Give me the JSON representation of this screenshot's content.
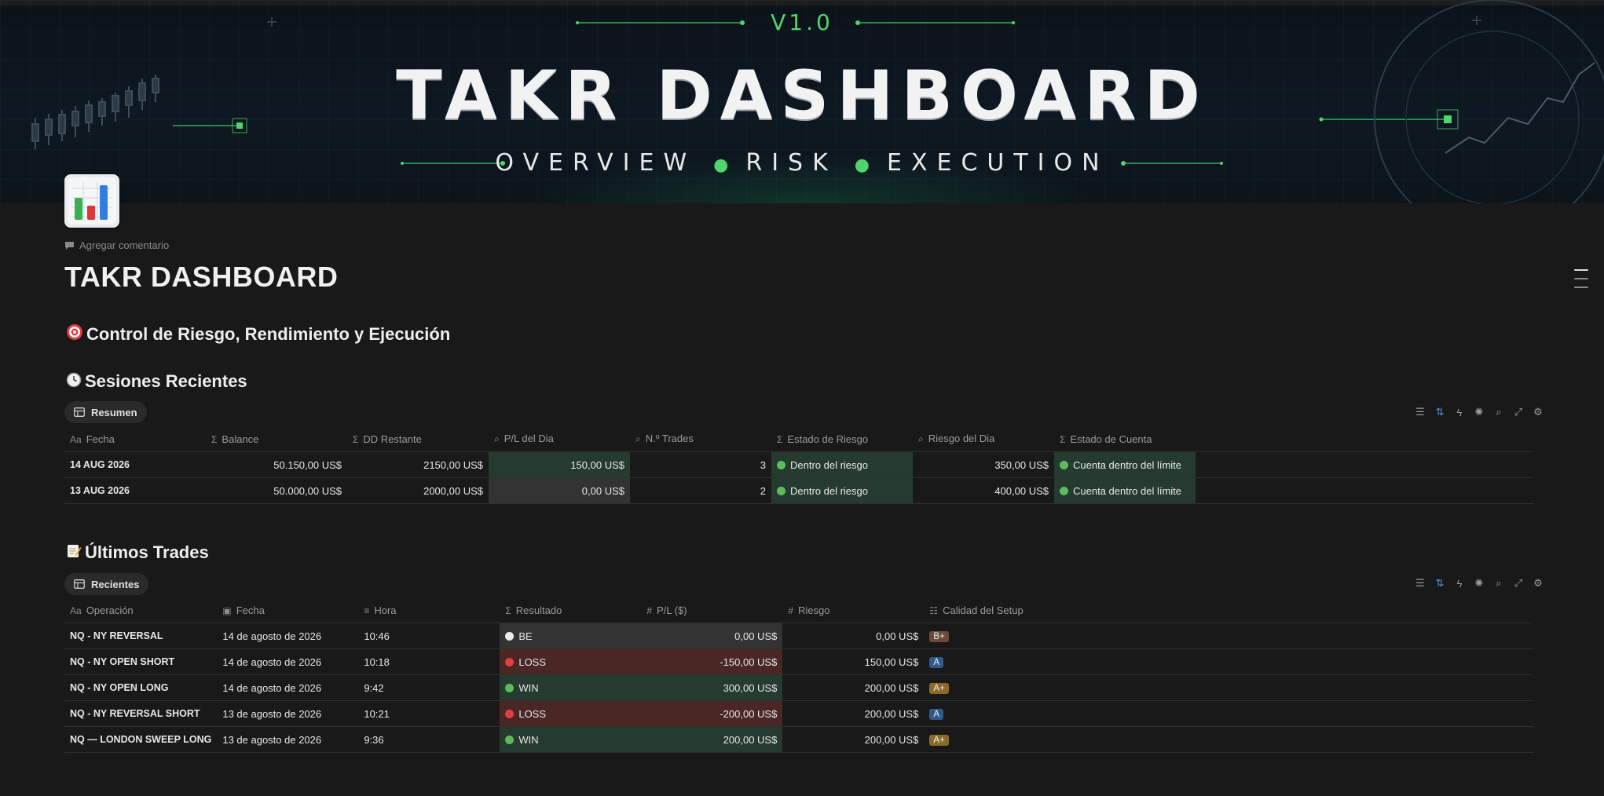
{
  "banner": {
    "version": "V1.0",
    "title": "TAKR DASHBOARD",
    "subtitle_parts": [
      "OVERVIEW",
      "RISK",
      "EXECUTION"
    ]
  },
  "page": {
    "add_comment": "Agregar comentario",
    "title": "TAKR DASHBOARD",
    "section_main": "Control de Riesgo, Rendimiento y Ejecución",
    "section_sessions": "Sesiones Recientes",
    "section_trades": "Últimos Trades"
  },
  "sessions": {
    "view_label": "Resumen",
    "headers": [
      "Fecha",
      "Balance",
      "DD Restante",
      "P/L del Dia",
      "N.º Trades",
      "Estado de Riesgo",
      "Riesgo del Dia",
      "Estado de Cuenta"
    ],
    "rows": [
      {
        "fecha": "14 AUG 2026",
        "balance": "50.150,00 US$",
        "dd": "2150,00 US$",
        "pl": "150,00 US$",
        "trades": "3",
        "estado_riesgo": "Dentro del riesgo",
        "riesgo_dia": "350,00 US$",
        "estado_cuenta": "Cuenta dentro del límite"
      },
      {
        "fecha": "13 AUG 2026",
        "balance": "50.000,00 US$",
        "dd": "2000,00 US$",
        "pl": "0,00 US$",
        "trades": "2",
        "estado_riesgo": "Dentro del riesgo",
        "riesgo_dia": "400,00 US$",
        "estado_cuenta": "Cuenta dentro del límite"
      }
    ]
  },
  "trades": {
    "view_label": "Recientes",
    "headers": [
      "Operación",
      "Fecha",
      "Hora",
      "Resultado",
      "P/L ($)",
      "Riesgo",
      "Calidad del Setup"
    ],
    "rows": [
      {
        "op": "NQ - NY REVERSAL",
        "fecha": "14 de agosto de 2026",
        "hora": "10:46",
        "resultado": "BE",
        "pl": "0,00 US$",
        "riesgo": "0,00 US$",
        "calidad": "B+"
      },
      {
        "op": "NQ - NY OPEN SHORT",
        "fecha": "14 de agosto de 2026",
        "hora": "10:18",
        "resultado": "LOSS",
        "pl": "-150,00 US$",
        "riesgo": "150,00 US$",
        "calidad": "A"
      },
      {
        "op": "NQ - NY OPEN LONG",
        "fecha": "14 de agosto de 2026",
        "hora": "9:42",
        "resultado": "WIN",
        "pl": "300,00 US$",
        "riesgo": "200,00 US$",
        "calidad": "A+"
      },
      {
        "op": "NQ - NY REVERSAL SHORT",
        "fecha": "13 de agosto de 2026",
        "hora": "10:21",
        "resultado": "LOSS",
        "pl": "-200,00 US$",
        "riesgo": "200,00 US$",
        "calidad": "A"
      },
      {
        "op": "NQ — LONDON SWEEP LONG",
        "fecha": "13 de agosto de 2026",
        "hora": "9:36",
        "resultado": "WIN",
        "pl": "200,00 US$",
        "riesgo": "200,00 US$",
        "calidad": "A+"
      }
    ]
  },
  "colors": {
    "accent_green": "#4fd46f",
    "win_bg": "#263b2f",
    "loss_bg": "#4a2625",
    "be_bg": "#333333",
    "tag_bplus": "#6b4a3a",
    "tag_a": "#2f5a8a",
    "tag_aplus": "#8a6a2a"
  },
  "icons": {
    "page_icon": "bar-chart-icon",
    "comment": "comment-icon",
    "section_main": "target-icon",
    "section_sessions": "clock-icon",
    "section_trades": "memo-icon"
  }
}
